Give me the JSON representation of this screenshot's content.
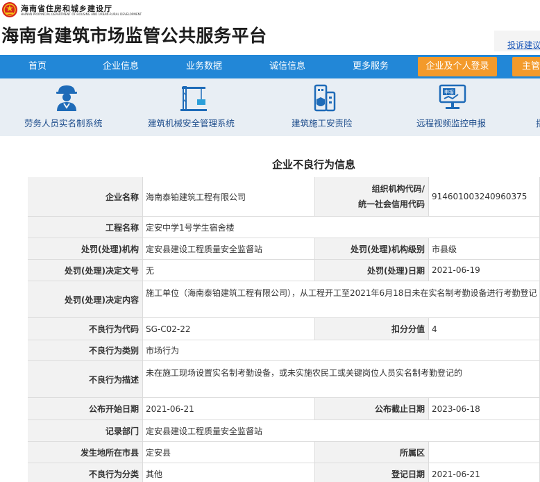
{
  "header": {
    "dept_name": "海南省住房和城乡建设厅",
    "dept_name_en": "HAINAN PROVINCIAL DEPARTMENT OF HOUSING AND URBAN-RURAL DEVELOPMENT",
    "site_title": "海南省建筑市场监管公共服务平台",
    "complaint_link": "投诉建议"
  },
  "nav": {
    "items": [
      "首页",
      "企业信息",
      "业务数据",
      "诚信信息",
      "更多服务"
    ],
    "login_button": "企业及个人登录",
    "admin_button": "主管"
  },
  "services": [
    {
      "label": "劳务人员实名制系统",
      "icon": "worker-icon"
    },
    {
      "label": "建筑机械安全管理系统",
      "icon": "crane-icon"
    },
    {
      "label": "建筑施工安责险",
      "icon": "insurance-building-icon"
    },
    {
      "label": "远程视频监控申报",
      "icon": "monitor-declare-icon"
    },
    {
      "label": "指",
      "icon": "more-icon"
    }
  ],
  "section_title": "企业不良行为信息",
  "record": {
    "company_name_label": "企业名称",
    "company_name": "海南泰铂建筑工程有限公司",
    "org_code_label_1": "组织机构代码/",
    "org_code_label_2": "统一社会信用代码",
    "org_code": "914601003240960375",
    "project_label": "工程名称",
    "project": "定安中学1号学生宿舍楼",
    "agency_label": "处罚(处理)机构",
    "agency": "定安县建设工程质量安全监督站",
    "agency_level_label": "处罚(处理)机构级别",
    "agency_level": "市县级",
    "decision_no_label": "处罚(处理)决定文号",
    "decision_no": "无",
    "decision_date_label": "处罚(处理)日期",
    "decision_date": "2021-06-19",
    "decision_content_label": "处罚(处理)决定内容",
    "decision_content": "施工单位（海南泰铂建筑工程有限公司），从工程开工至2021年6月18日未在实名制考勤设备进行考勤登记",
    "behavior_code_label": "不良行为代码",
    "behavior_code": "SG-C02-22",
    "deduction_label": "扣分分值",
    "deduction": "4",
    "behavior_type_label": "不良行为类别",
    "behavior_type": "市场行为",
    "behavior_desc_label": "不良行为描述",
    "behavior_desc": "未在施工现场设置实名制考勤设备，或未实施农民工或关键岗位人员实名制考勤登记的",
    "publish_start_label": "公布开始日期",
    "publish_start": "2021-06-21",
    "publish_end_label": "公布截止日期",
    "publish_end": "2023-06-18",
    "record_dept_label": "记录部门",
    "record_dept": "定安县建设工程质量安全监督站",
    "city_label": "发生地所在市县",
    "city": "定安县",
    "district_label": "所属区",
    "district": "",
    "category_label": "不良行为分类",
    "category": "其他",
    "register_date_label": "登记日期",
    "register_date": "2021-06-21"
  },
  "colors": {
    "nav_blue": "#2287d7",
    "login_orange": "#f39a2b",
    "service_bg": "#e8eef4",
    "label_bg": "#f2f2f2",
    "icon_blue": "#1e6bb8"
  }
}
